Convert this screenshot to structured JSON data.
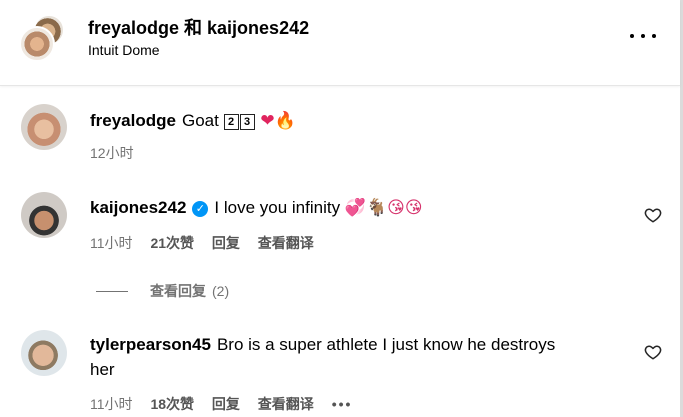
{
  "header": {
    "title": "freyalodge 和 kaijones242",
    "subtitle": "Intuit Dome"
  },
  "comments": [
    {
      "username": "freyalodge",
      "text": "Goat",
      "keycaps": [
        "2",
        "3"
      ],
      "emoji_after": "❤🔥",
      "time": "12小时"
    },
    {
      "username": "kaijones242",
      "verified": true,
      "text": "I love you infinity",
      "emoji_after": "💞🐐😘😘",
      "time": "11小时",
      "likes": "21次赞",
      "reply": "回复",
      "translate": "查看翻译"
    },
    {
      "username": "tylerpearson45",
      "text_line1": "Bro is a super athlete I just know he destroys",
      "text_line2": "her",
      "time": "11小时",
      "likes": "18次赞",
      "reply": "回复",
      "translate": "查看翻译",
      "more": "•••"
    }
  ],
  "replies": {
    "label": "查看回复",
    "count": "(2)"
  },
  "icons": {
    "more": "more-horizontal-icon",
    "like": "heart-outline-icon",
    "verified": "verified-badge-icon"
  },
  "colors": {
    "verified": "#0095f6",
    "meta_text": "#737373"
  }
}
